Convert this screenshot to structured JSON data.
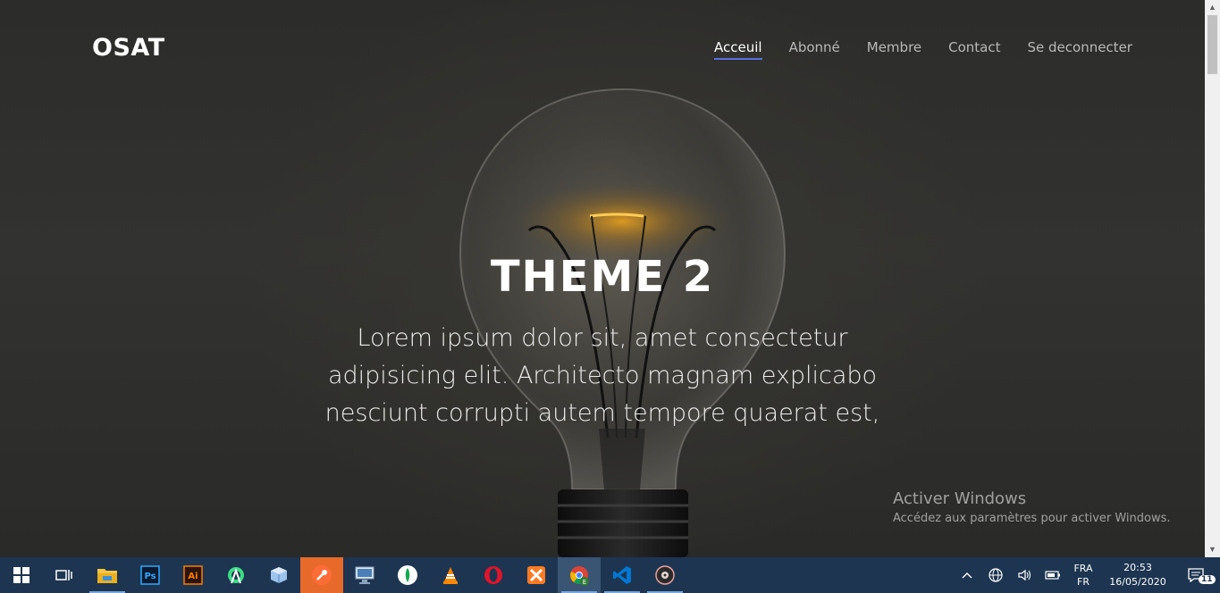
{
  "browser_page": {
    "brand": "OSAT",
    "nav": {
      "items": [
        {
          "label": "Acceuil",
          "active": true
        },
        {
          "label": "Abonné",
          "active": false
        },
        {
          "label": "Membre",
          "active": false
        },
        {
          "label": "Contact",
          "active": false
        },
        {
          "label": "Se deconnecter",
          "active": false
        }
      ],
      "accent_color": "#5b6ee1"
    },
    "hero": {
      "title": "THEME 2",
      "text": "Lorem ipsum dolor sit, amet consectetur adipisicing elit. Architecto magnam explicabo nesciunt corrupti autem tempore quaerat est,",
      "background": "light-bulb-photo"
    }
  },
  "windows_activation": {
    "title": "Activer Windows",
    "subtitle": "Accédez aux paramètres pour activer Windows."
  },
  "taskbar": {
    "apps": [
      {
        "name": "windows-start-icon"
      },
      {
        "name": "task-view-icon"
      },
      {
        "name": "file-explorer-icon"
      },
      {
        "name": "photoshop-icon",
        "label": "Ps"
      },
      {
        "name": "illustrator-icon",
        "label": "Ai"
      },
      {
        "name": "android-studio-icon"
      },
      {
        "name": "virtualbox-icon"
      },
      {
        "name": "postman-icon"
      },
      {
        "name": "remote-desktop-icon"
      },
      {
        "name": "mongodb-compass-icon"
      },
      {
        "name": "vlc-icon"
      },
      {
        "name": "opera-icon"
      },
      {
        "name": "xampp-icon"
      },
      {
        "name": "chrome-icon",
        "label": "E"
      },
      {
        "name": "vscode-icon"
      },
      {
        "name": "media-player-icon"
      }
    ],
    "tray": {
      "language_top": "FRA",
      "language_bottom": "FR",
      "time": "20:53",
      "date": "16/05/2020",
      "notification_count": "11"
    },
    "bg_color": "#1d3550"
  }
}
